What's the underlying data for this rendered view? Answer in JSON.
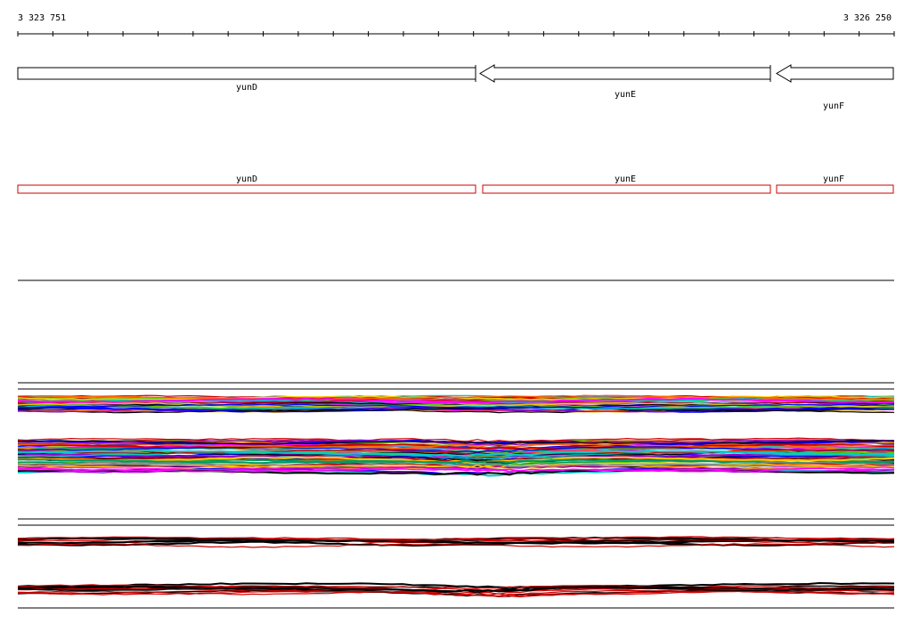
{
  "ruler": {
    "start_label": "3 323 751",
    "end_label": "3 326 250"
  },
  "annotated_genes": [
    {
      "name": "yunD",
      "strand": "+"
    },
    {
      "name": "yunE",
      "strand": "-"
    },
    {
      "name": "yunF",
      "strand": "-"
    }
  ],
  "predicted_genes": [
    {
      "name": "yunD"
    },
    {
      "name": "yunE"
    },
    {
      "name": "yunF"
    }
  ],
  "colors": {
    "gene_box": "#000000",
    "predicted_box": "#cc0000",
    "track_palette": [
      "#000000",
      "#cc0000",
      "#00cccc",
      "#ff00ff",
      "#66cc00",
      "#ffcc00",
      "#0000ff",
      "#ff6600",
      "#9900cc",
      "#009966",
      "#888888"
    ]
  }
}
